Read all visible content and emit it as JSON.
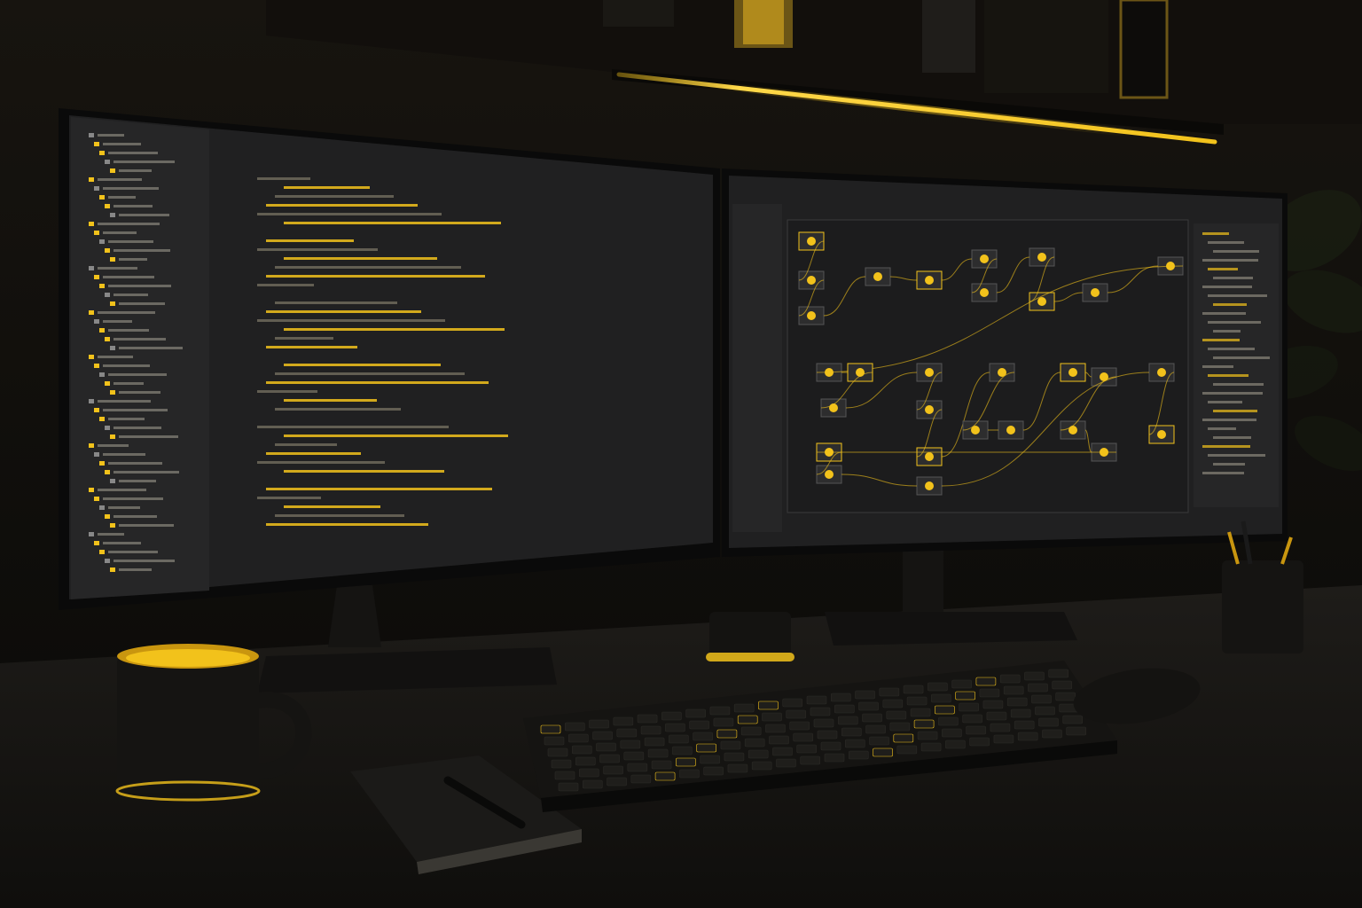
{
  "scene": {
    "description_visible_text": [],
    "colors": {
      "accent": "#f2c21b",
      "background": "#0b0a08",
      "wall": "#14120f",
      "desk": "#1b1916",
      "screen_bg": "#202021",
      "panel": "#2a2a2b",
      "code_dim": "#6f6a5a"
    },
    "objects": {
      "left_monitor": "code-editor-monitor",
      "right_monitor": "node-graph-editor-monitor",
      "keyboard": "keyboard",
      "mouse": "mouse",
      "mug": "coffee-mug",
      "notebook": "notebook",
      "pen": "pen",
      "pen_cup": "pen-holder",
      "plant": "plant",
      "shelf": "shelf",
      "light_strip": "led-light-strip"
    }
  }
}
